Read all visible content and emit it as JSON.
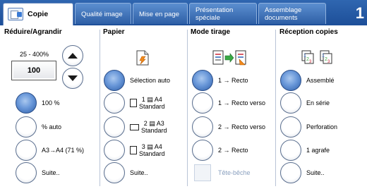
{
  "tabs": [
    {
      "label": "Copie",
      "active": true
    },
    {
      "label": "Qualité image"
    },
    {
      "label": "Mise en page"
    },
    {
      "label": "Présentation spéciale",
      "line1": "Présentation",
      "line2": "spéciale"
    },
    {
      "label": "Assemblage documents",
      "line1": "Assemblage",
      "line2": "documents"
    }
  ],
  "page_indicator": "1",
  "reduce": {
    "heading": "Réduire/Agrandir",
    "range": "25 - 400%",
    "value": "100",
    "options": [
      {
        "label": "100 %",
        "selected": true
      },
      {
        "label": "% auto",
        "selected": false
      },
      {
        "label": "A3→A4 (71 %)",
        "selected": false
      },
      {
        "label": "Suite..",
        "selected": false
      }
    ]
  },
  "paper": {
    "heading": "Papier",
    "options": [
      {
        "label": "Sélection auto",
        "selected": true
      },
      {
        "tray": "1",
        "size": "A4",
        "type": "Standard",
        "selected": false
      },
      {
        "tray": "2",
        "size": "A3",
        "type": "Standard",
        "selected": false
      },
      {
        "tray": "3",
        "size": "A4",
        "type": "Standard",
        "selected": false
      },
      {
        "label": "Suite..",
        "selected": false
      }
    ]
  },
  "mode": {
    "heading": "Mode tirage",
    "options": [
      {
        "label": "1 → Recto",
        "selected": true
      },
      {
        "label": "1 → Recto verso",
        "selected": false
      },
      {
        "label": "2 → Recto verso",
        "selected": false
      },
      {
        "label": "2 → Recto",
        "selected": false
      }
    ],
    "head_to_head": {
      "label": "Tête-bêche",
      "enabled": false
    }
  },
  "output": {
    "heading": "Réception copies",
    "options": [
      {
        "label": "Assemblé",
        "selected": true
      },
      {
        "label": "En série",
        "selected": false
      },
      {
        "label": "Perforation",
        "selected": false
      },
      {
        "label": "1 agrafe",
        "selected": false
      },
      {
        "label": "Suite..",
        "selected": false
      }
    ]
  },
  "icons": {
    "copy_tab": "copy-icon",
    "paper_auto": "paper-tray-icon",
    "duplex_mode": "duplex-icon",
    "collation": "collated-sets-icon"
  },
  "colors": {
    "tab_bar": "#1d4f99",
    "selected_radio": "#2e5ea8",
    "disabled_text": "#8aa0bf"
  }
}
